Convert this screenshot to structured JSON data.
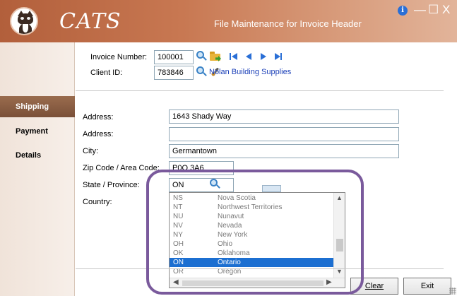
{
  "app": {
    "name": "CATS",
    "window_title": "File Maintenance for Invoice Header"
  },
  "window_controls": {
    "info": "i",
    "minimize": "—",
    "maximize": "☐",
    "close": "X"
  },
  "header": {
    "invoice_label": "Invoice Number:",
    "invoice_value": "100001",
    "client_label": "Client ID:",
    "client_value": "783846",
    "client_name": "Nolan Building Supplies"
  },
  "sidebar": {
    "items": [
      {
        "label": "Shipping",
        "active": true
      },
      {
        "label": "Payment",
        "active": false
      },
      {
        "label": "Details",
        "active": false
      }
    ]
  },
  "form": {
    "address1_label": "Address:",
    "address1_value": "1643 Shady Way",
    "address2_label": "Address:",
    "address2_value": "",
    "city_label": "City:",
    "city_value": "Germantown",
    "zip_label": "Zip Code / Area Code:",
    "zip_value": "P0O 3A6",
    "state_label": "State / Province:",
    "state_value": "ON",
    "country_label": "Country:"
  },
  "province_list": {
    "options": [
      {
        "code": "NS",
        "name": "Nova Scotia"
      },
      {
        "code": "NT",
        "name": "Northwest Territories"
      },
      {
        "code": "NU",
        "name": "Nunavut"
      },
      {
        "code": "NV",
        "name": "Nevada"
      },
      {
        "code": "NY",
        "name": "New York"
      },
      {
        "code": "OH",
        "name": "Ohio"
      },
      {
        "code": "OK",
        "name": "Oklahoma"
      },
      {
        "code": "ON",
        "name": "Ontario"
      },
      {
        "code": "OR",
        "name": "Oregon"
      }
    ],
    "selected_code": "ON"
  },
  "buttons": {
    "clear_label": "Clear",
    "exit_label": "Exit"
  },
  "colors": {
    "title_bar": "#c06f4a",
    "sidebar_active": "#8a5e44",
    "selection": "#1c6fd1",
    "client_link": "#1a3fb8",
    "highlight_ring": "#7a5a9c"
  }
}
